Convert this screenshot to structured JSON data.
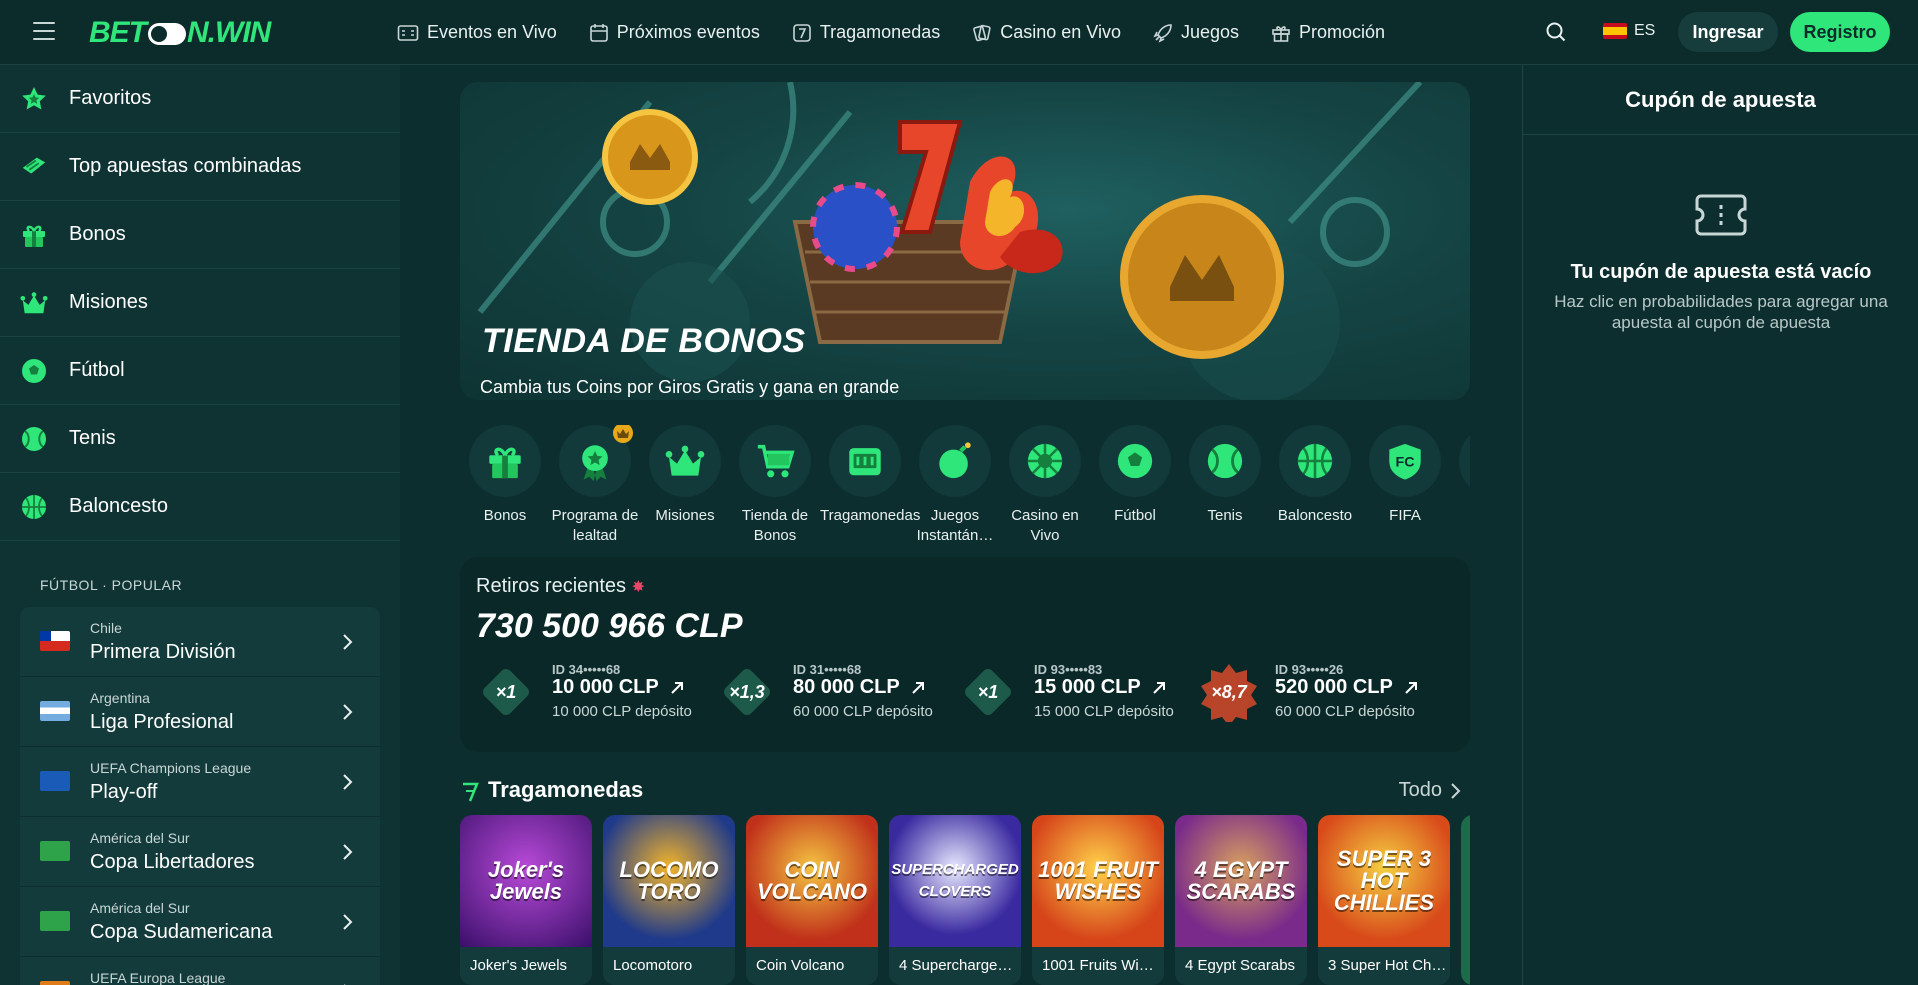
{
  "header": {
    "logo": {
      "part1": "BET",
      "part2": "N.WIN"
    },
    "nav": [
      {
        "label": "Eventos en Vivo",
        "icon": "live-scoreboard-icon"
      },
      {
        "label": "Próximos eventos",
        "icon": "calendar-icon"
      },
      {
        "label": "Tragamonedas",
        "icon": "slot-seven-icon"
      },
      {
        "label": "Casino en Vivo",
        "icon": "cards-icon"
      },
      {
        "label": "Juegos",
        "icon": "rocket-icon"
      },
      {
        "label": "Promoción",
        "icon": "gift-icon"
      }
    ],
    "language": "ES",
    "login_label": "Ingresar",
    "register_label": "Registro"
  },
  "sidebar": {
    "items": [
      {
        "label": "Favoritos",
        "icon": "star-icon"
      },
      {
        "label": "Top apuestas combinadas",
        "icon": "ticket-icon"
      },
      {
        "label": "Bonos",
        "icon": "gift-icon"
      },
      {
        "label": "Misiones",
        "icon": "crown-icon"
      },
      {
        "label": "Fútbol",
        "icon": "soccer-ball-icon"
      },
      {
        "label": "Tenis",
        "icon": "tennis-ball-icon"
      },
      {
        "label": "Baloncesto",
        "icon": "basketball-icon"
      }
    ],
    "section_title": "FÚTBOL · POPULAR",
    "leagues": [
      {
        "country": "Chile",
        "name": "Primera División",
        "flag": "chile-flag"
      },
      {
        "country": "Argentina",
        "name": "Liga Profesional",
        "flag": "argentina-flag"
      },
      {
        "country": "UEFA Champions League",
        "name": "Play-off",
        "flag": "uefa-flag"
      },
      {
        "country": "América del Sur",
        "name": "Copa Libertadores",
        "flag": "south-america-flag"
      },
      {
        "country": "América del Sur",
        "name": "Copa Sudamericana",
        "flag": "south-america-flag"
      },
      {
        "country": "UEFA Europa League",
        "name": "",
        "flag": "europa-league-flag"
      }
    ]
  },
  "banner": {
    "title": "TIENDA DE BONOS",
    "subtitle": "Cambia tus Coins por Giros Gratis y gana en grande"
  },
  "categories": [
    {
      "label": "Bonos",
      "icon": "gift-icon"
    },
    {
      "label": "Programa de lealtad",
      "icon": "loyalty-medal-icon"
    },
    {
      "label": "Misiones",
      "icon": "crown-icon"
    },
    {
      "label": "Tienda de Bonos",
      "icon": "shopping-cart-icon"
    },
    {
      "label": "Tragamonedas",
      "icon": "slot-machine-icon"
    },
    {
      "label": "Juegos Instantán…",
      "icon": "bomb-icon"
    },
    {
      "label": "Casino en Vivo",
      "icon": "roulette-icon"
    },
    {
      "label": "Fútbol",
      "icon": "soccer-ball-icon"
    },
    {
      "label": "Tenis",
      "icon": "tennis-ball-icon"
    },
    {
      "label": "Baloncesto",
      "icon": "basketball-icon"
    },
    {
      "label": "FIFA",
      "icon": "fifa-shield-icon"
    }
  ],
  "withdrawals": {
    "title": "Retiros recientes",
    "total": "730 500 966 CLP",
    "items": [
      {
        "id": "ID 34•••••68",
        "multiplier": "×1",
        "win": "10 000 CLP",
        "deposit": "10 000 CLP depósito",
        "color": "#1d5a4a"
      },
      {
        "id": "ID 31•••••68",
        "multiplier": "×1,3",
        "win": "80 000 CLP",
        "deposit": "60 000 CLP depósito",
        "color": "#1d5a4a"
      },
      {
        "id": "ID 93•••••83",
        "multiplier": "×1",
        "win": "15 000 CLP",
        "deposit": "15 000 CLP depósito",
        "color": "#1d5a4a"
      },
      {
        "id": "ID 93•••••26",
        "multiplier": "×8,7",
        "win": "520 000 CLP",
        "deposit": "60 000 CLP depósito",
        "color": "#b8442a"
      }
    ]
  },
  "slots": {
    "title": "Tragamonedas",
    "all_label": "Todo",
    "games": [
      {
        "name": "Joker's Jewels",
        "art": "Joker's Jewels",
        "bg": "#5a1f8a"
      },
      {
        "name": "Locomotoro",
        "art": "LOCOMO TORO",
        "bg": "#1f3a8a"
      },
      {
        "name": "Coin Volcano",
        "art": "COIN VOLCANO",
        "bg": "#c0301a"
      },
      {
        "name": "4 Supercharge…",
        "art": "SUPERCHARGED CLOVERS",
        "bg": "#3a2aa0"
      },
      {
        "name": "1001 Fruits Wi…",
        "art": "1001 FRUIT WISHES",
        "bg": "#d6451a"
      },
      {
        "name": "4 Egypt Scarabs",
        "art": "4 EGYPT SCARABS",
        "bg": "#7a2a8a"
      },
      {
        "name": "3 Super Hot Ch…",
        "art": "SUPER 3 HOT CHILLIES",
        "bg": "#d84a1a"
      }
    ]
  },
  "betslip": {
    "title": "Cupón de apuesta",
    "empty_title": "Tu cupón de apuesta está vacío",
    "empty_hint": "Haz clic en probabilidades para agregar una apuesta al cupón de apuesta"
  },
  "colors": {
    "accent": "#2ee67a",
    "background": "#0d2e2e",
    "panel": "#0f3333"
  }
}
